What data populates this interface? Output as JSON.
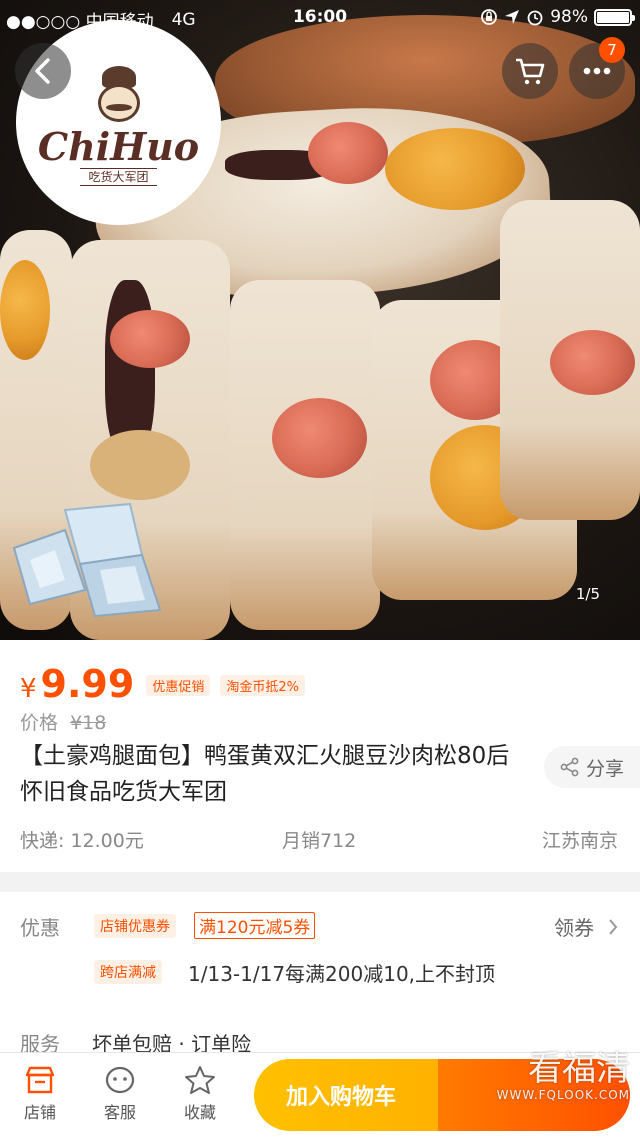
{
  "status_bar": {
    "carrier": "●●○○○ 中国移动",
    "network": "4G",
    "time": "16:00",
    "battery": "98%"
  },
  "hero": {
    "logo_brand": "ChiHuo",
    "logo_sub": "吃货大军团",
    "cart_badge": "7",
    "counter": "1/5"
  },
  "product": {
    "currency": "¥",
    "price": "9.99",
    "tags": [
      "优惠促销",
      "淘金币抵2%"
    ],
    "orig_label": "价格",
    "orig_price": "¥18",
    "title": "【土豪鸡腿面包】鸭蛋黄双汇火腿豆沙肉松80后怀旧食品吃货大军团",
    "share_label": "分享",
    "shipping": "快递: 12.00元",
    "monthly_sales": "月销712",
    "location": "江苏南京"
  },
  "promo": {
    "label": "优惠",
    "shop_coupon_tag": "店铺优惠券",
    "shop_coupon_value": "满120元减5券",
    "get_coupon": "领券",
    "cross_store_tag": "跨店满减",
    "cross_store_text": "1/13-1/17每满200减10,上不封顶",
    "service_label": "服务",
    "service_text": "坏单包赔 · 订单险"
  },
  "bottom_bar": {
    "shop": "店铺",
    "service": "客服",
    "favorite": "收藏",
    "add_to_cart": "加入购物车"
  },
  "watermark": {
    "text": "看福清",
    "url": "WWW.FQLOOK.COM"
  },
  "colors": {
    "accent": "#ff5000",
    "cart_button": "#ffa300"
  }
}
